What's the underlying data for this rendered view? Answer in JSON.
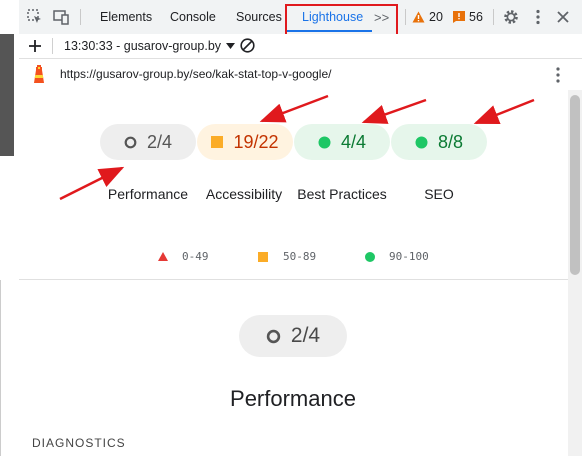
{
  "toolbar": {
    "tabs": [
      "Elements",
      "Console",
      "Sources",
      "Lighthouse"
    ],
    "more_label": ">>",
    "warnings_count": "20",
    "issues_count": "56"
  },
  "report_bar": {
    "timestamp_label": "13:30:33 - gusarov-group.by"
  },
  "url_bar": {
    "url": "https://gusarov-group.by/seo/kak-stat-top-v-google/"
  },
  "gauges": [
    {
      "score": "2/4",
      "label": "Performance"
    },
    {
      "score": "19/22",
      "label": "Accessibility"
    },
    {
      "score": "4/4",
      "label": "Best Practices"
    },
    {
      "score": "8/8",
      "label": "SEO"
    }
  ],
  "legend": [
    {
      "range": "0-49",
      "color": "#e53935"
    },
    {
      "range": "50-89",
      "color": "#fbac27"
    },
    {
      "range": "90-100",
      "color": "#1ec765"
    }
  ],
  "section": {
    "score": "2/4",
    "title": "Performance",
    "diagnostics_label": "DIAGNOSTICS"
  },
  "colors": {
    "accent": "#1a73e8",
    "annotation_red": "#e0191d"
  }
}
